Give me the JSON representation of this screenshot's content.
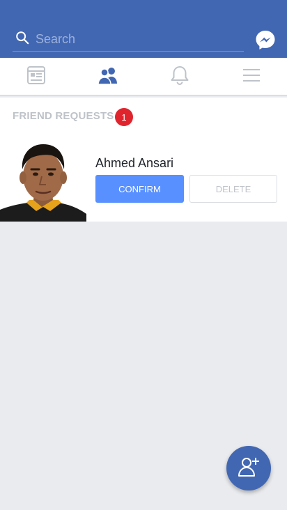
{
  "colors": {
    "brand": "#4267b2",
    "badge": "#e0242e",
    "confirm": "#5890ff",
    "background": "#e9ebee"
  },
  "header": {
    "search": {
      "placeholder": "Search",
      "value": "",
      "icon": "search-icon"
    },
    "messenger_icon": "messenger-icon"
  },
  "tabs": [
    {
      "icon": "news-feed-icon",
      "active": false
    },
    {
      "icon": "friends-icon",
      "active": true
    },
    {
      "icon": "bell-icon",
      "active": false
    },
    {
      "icon": "menu-icon",
      "active": false
    }
  ],
  "friend_requests": {
    "title": "FRIEND REQUESTS",
    "count": "1",
    "items": [
      {
        "name": "Ahmed Ansari",
        "confirm_label": "CONFIRM",
        "delete_label": "DELETE"
      }
    ]
  },
  "fab": {
    "icon": "add-friend-icon"
  }
}
